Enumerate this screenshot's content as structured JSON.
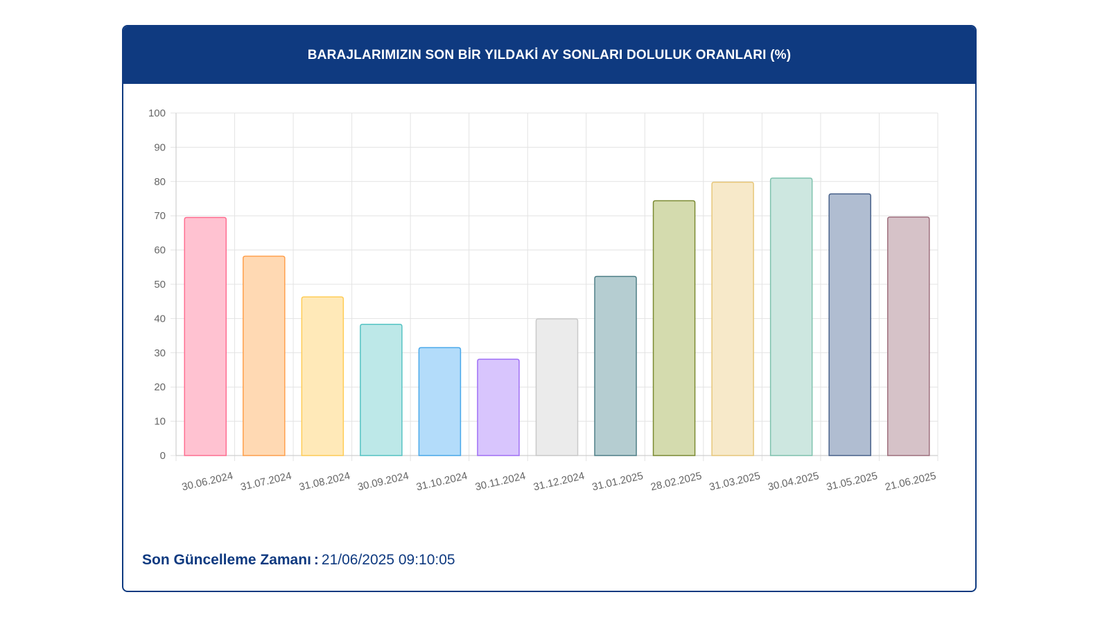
{
  "header": {
    "title": "BARAJLARIMIZIN SON BİR YILDAKİ AY SONLARI DOLULUK ORANLARI (%)"
  },
  "footer": {
    "label": "Son Güncelleme Zamanı",
    "separator": ":",
    "value": "21/06/2025 09:10:05"
  },
  "colors": {
    "header_bg": "#0f3a80",
    "footer_text": "#0f3a80",
    "grid": "#e3e3e3",
    "axis_text": "#666666"
  },
  "chart_data": {
    "type": "bar",
    "categories": [
      "30.06.2024",
      "31.07.2024",
      "31.08.2024",
      "30.09.2024",
      "31.10.2024",
      "30.11.2024",
      "31.12.2024",
      "31.01.2025",
      "28.02.2025",
      "31.03.2025",
      "30.04.2025",
      "31.05.2025",
      "21.06.2025"
    ],
    "values": [
      69.5,
      58.2,
      46.3,
      38.3,
      31.5,
      28.1,
      39.9,
      52.3,
      74.4,
      79.8,
      81.0,
      76.4,
      69.6
    ],
    "ylim": [
      0,
      100
    ],
    "yticks": [
      0,
      10,
      20,
      30,
      40,
      50,
      60,
      70,
      80,
      90,
      100
    ],
    "grid": true,
    "bar_fills": [
      "#ffc2d1",
      "#ffd9b3",
      "#ffe9b8",
      "#bde8e8",
      "#b3dcfa",
      "#d8c5fd",
      "#ebebeb",
      "#b5cdd1",
      "#d4dbae",
      "#f7e9c9",
      "#cde7e0",
      "#b0bdd1",
      "#d6c2c8"
    ],
    "bar_strokes": [
      "#ff6f91",
      "#ffa04d",
      "#ffcc55",
      "#55c3c3",
      "#48a8ea",
      "#9f6ff5",
      "#c9c9c9",
      "#4f7f87",
      "#7a8a32",
      "#e7c77a",
      "#7fc2ae",
      "#48618a",
      "#9e6f7d"
    ]
  }
}
